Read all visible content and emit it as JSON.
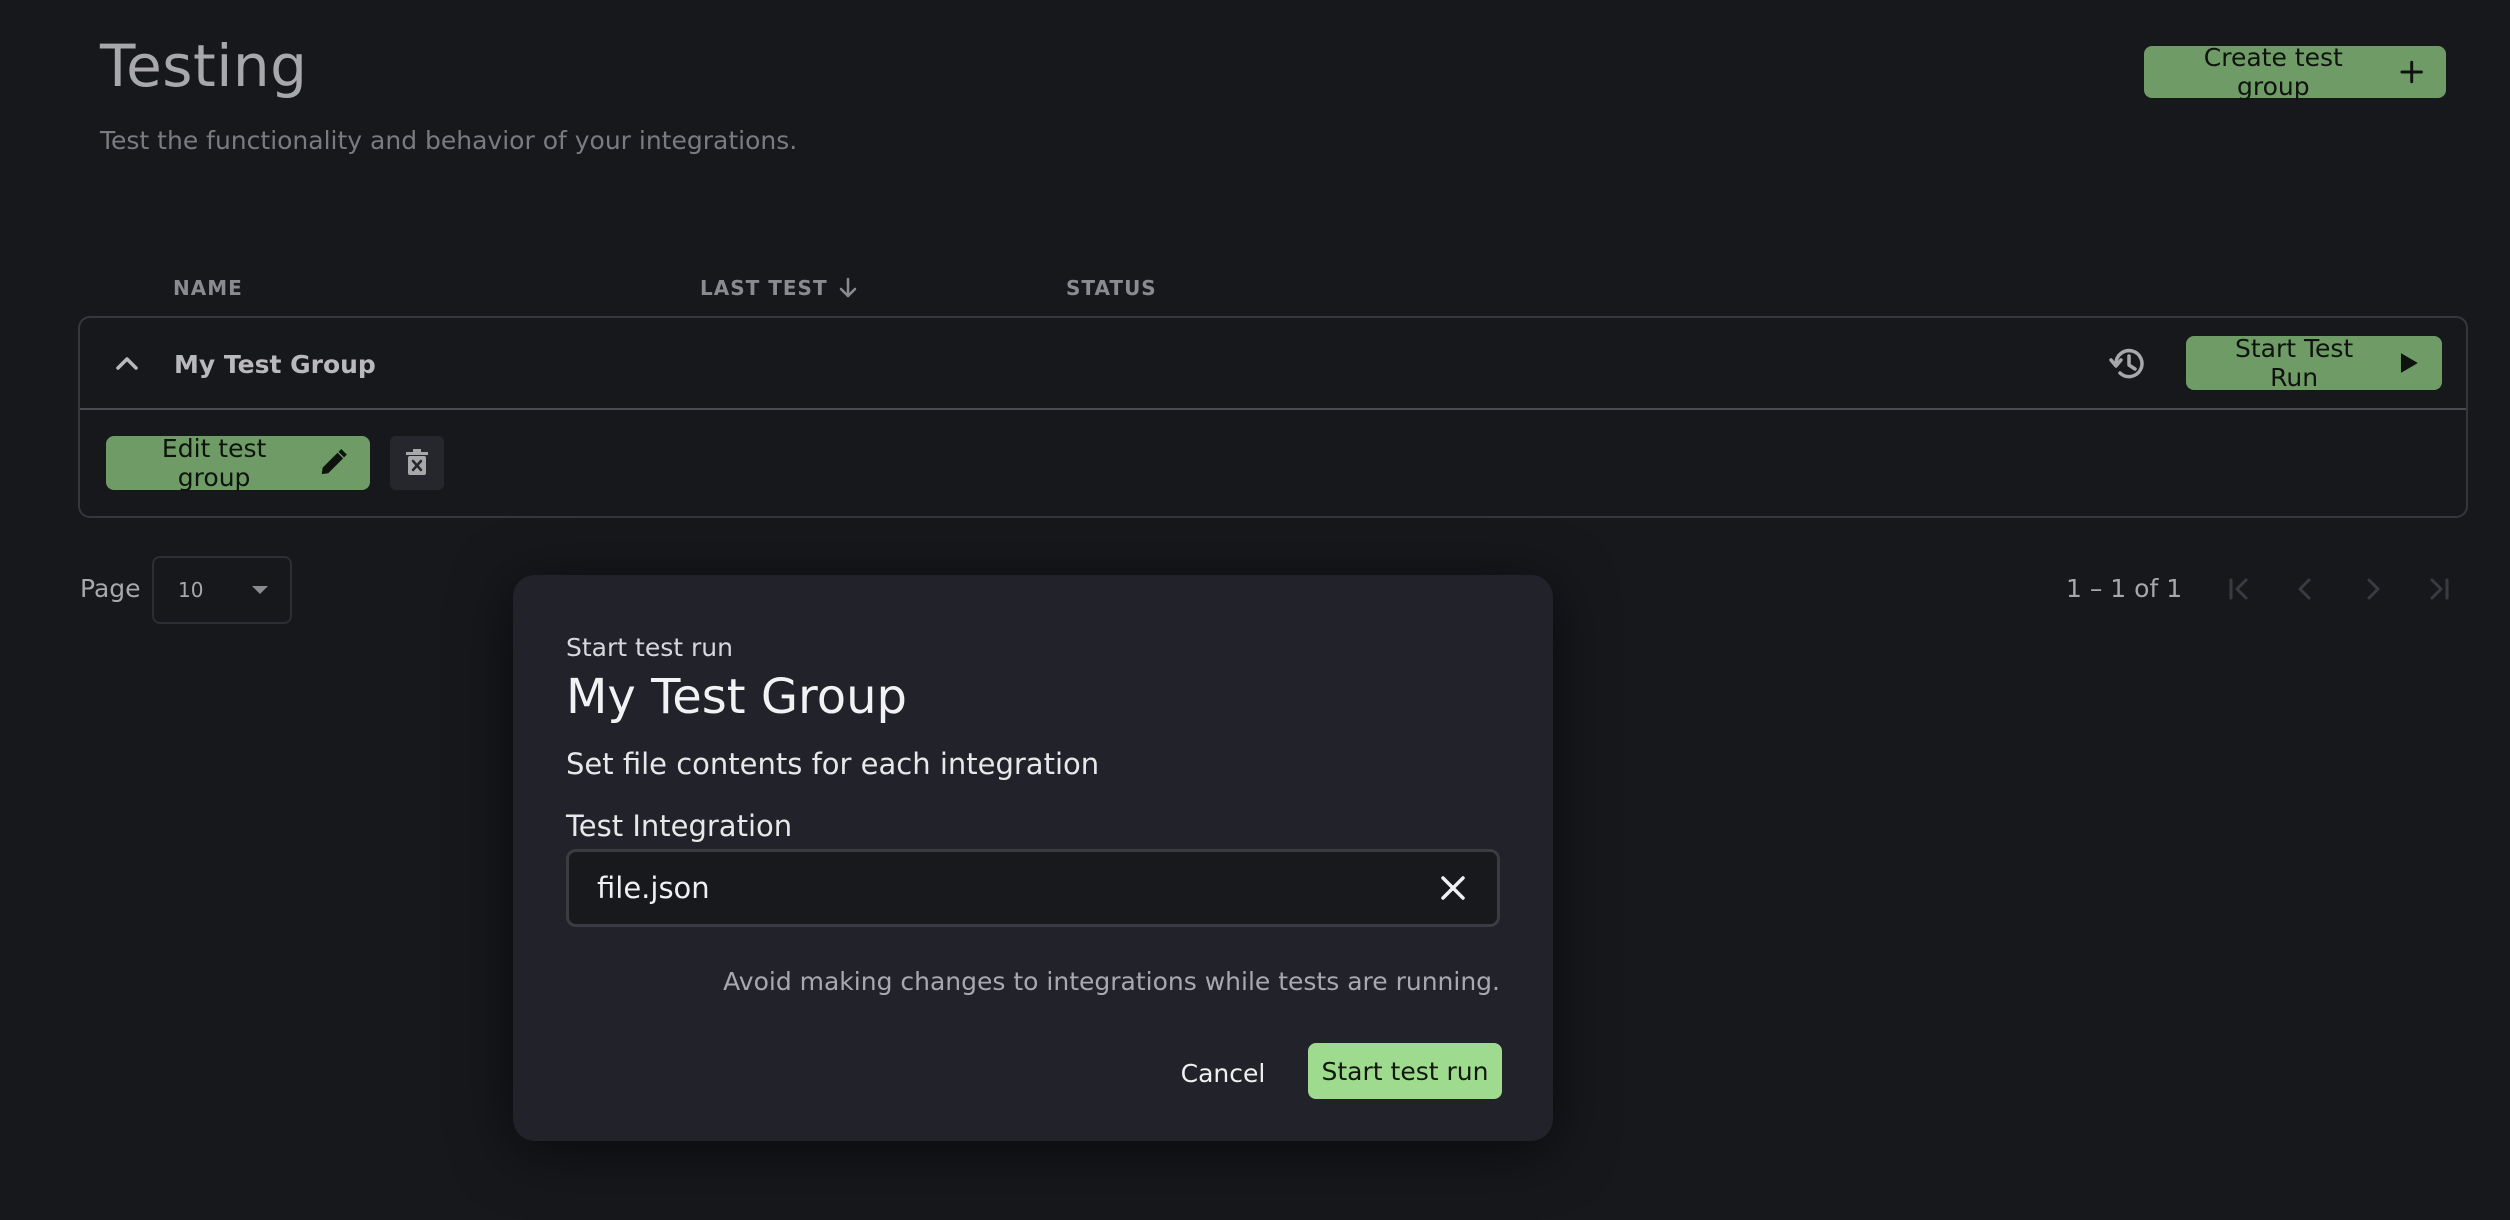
{
  "header": {
    "title": "Testing",
    "subtitle": "Test the functionality and behavior of your integrations.",
    "create_button_label": "Create test group"
  },
  "table": {
    "columns": [
      "NAME",
      "LAST TEST",
      "STATUS"
    ],
    "sort_icon": "arrow-down-icon",
    "group": {
      "name": "My Test Group",
      "start_button_label": "Start Test Run",
      "edit_button_label": "Edit test group"
    }
  },
  "pagination": {
    "page_label": "Page",
    "page_size": "10",
    "range_text": "1 – 1 of 1"
  },
  "modal": {
    "eyebrow": "Start test run",
    "title": "My Test Group",
    "section_heading": "Set file contents for each integration",
    "field_label": "Test Integration",
    "field_value": "file.json",
    "warning": "Avoid making changes to integrations while tests are running.",
    "cancel_label": "Cancel",
    "confirm_label": "Start test run"
  },
  "colors": {
    "background": "#17181c",
    "accent_green": "#6f9c66",
    "confirm_green": "#9fdb8f",
    "modal_bg": "#22232a"
  }
}
